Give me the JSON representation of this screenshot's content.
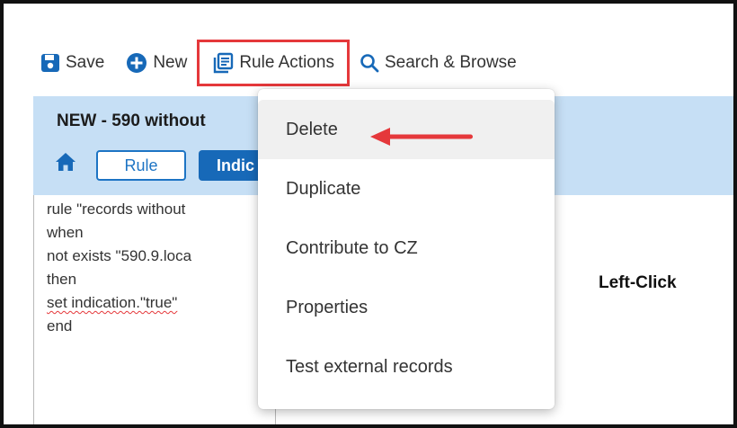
{
  "toolbar": {
    "save_label": "Save",
    "new_label": "New",
    "rule_actions_label": "Rule Actions",
    "search_label": "Search & Browse"
  },
  "header": {
    "title": "NEW - 590 without",
    "tabs": [
      {
        "label": "Rule"
      },
      {
        "label": "Indic"
      }
    ]
  },
  "editor": {
    "lines": [
      "rule \"records without",
      "when",
      "not exists \"590.9.loca",
      "then",
      "set indication.\"true\"",
      "end"
    ]
  },
  "dropdown": {
    "items": [
      {
        "label": "Delete"
      },
      {
        "label": "Duplicate"
      },
      {
        "label": "Contribute to CZ"
      },
      {
        "label": "Properties"
      },
      {
        "label": "Test external records"
      }
    ]
  },
  "annotation": {
    "text": "Left-Click"
  },
  "colors": {
    "accent": "#1769b8",
    "highlight": "#e5383b",
    "header_band": "#c6dff5"
  },
  "icons": [
    "save-icon",
    "plus-circle-icon",
    "rule-actions-icon",
    "search-icon",
    "home-icon",
    "arrow-left-icon"
  ]
}
